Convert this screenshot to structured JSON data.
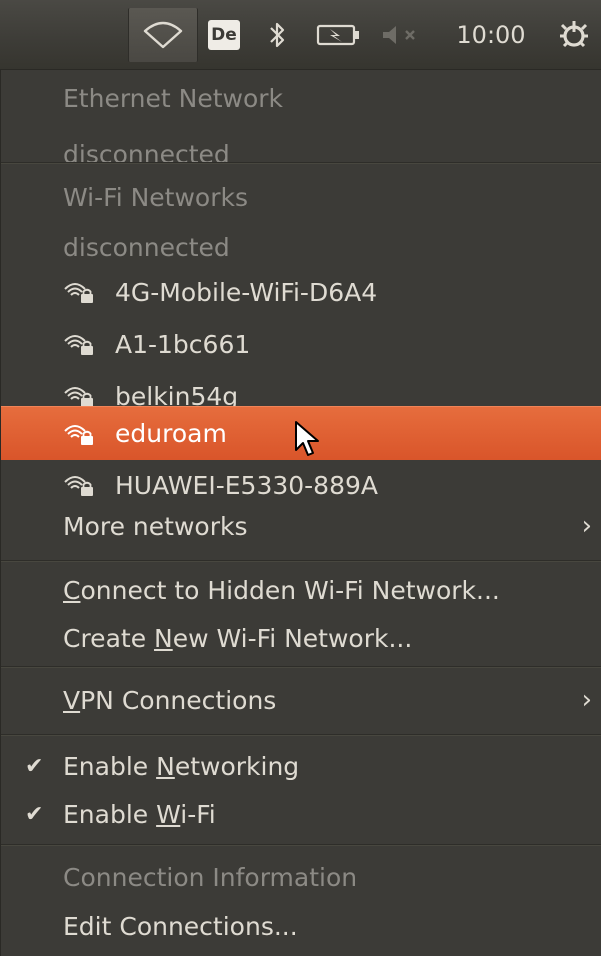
{
  "panel": {
    "keyboard_layout": "De",
    "clock": "10:00",
    "icons": [
      "wifi-icon",
      "bluetooth-icon",
      "battery-icon",
      "volume-muted-icon",
      "power-icon"
    ]
  },
  "menu": {
    "ethernet": {
      "title": "Ethernet Network",
      "status": "disconnected"
    },
    "wifi": {
      "title": "Wi-Fi Networks",
      "status": "disconnected",
      "networks": [
        {
          "ssid": "4G-Mobile-WiFi-D6A4",
          "secured": true
        },
        {
          "ssid": "A1-1bc661",
          "secured": true
        },
        {
          "ssid": "belkin54g",
          "secured": true
        },
        {
          "ssid": "eduroam",
          "secured": true,
          "highlighted": true
        },
        {
          "ssid": "HUAWEI-E5330-889A",
          "secured": true
        }
      ],
      "more": "More networks"
    },
    "connect_hidden": {
      "pre": "",
      "u": "C",
      "post": "onnect to Hidden Wi-Fi Network..."
    },
    "create_new": {
      "pre": "Create ",
      "u": "N",
      "post": "ew Wi-Fi Network..."
    },
    "vpn": {
      "pre": "",
      "u": "V",
      "post": "PN Connections"
    },
    "enable_networking": {
      "pre": "Enable ",
      "u": "N",
      "post": "etworking",
      "checked": true
    },
    "enable_wifi": {
      "pre": "Enable ",
      "u": "W",
      "post": "i-Fi",
      "checked": true
    },
    "connection_info": "Connection Information",
    "edit_connections": "Edit Connections...",
    "check_mark": "✔",
    "submenu_arrow": "›"
  },
  "colors": {
    "menu_bg": "#3c3b37",
    "highlight": "#e0612f",
    "text": "#dfdbd2",
    "disabled_text": "#8c8a85"
  }
}
